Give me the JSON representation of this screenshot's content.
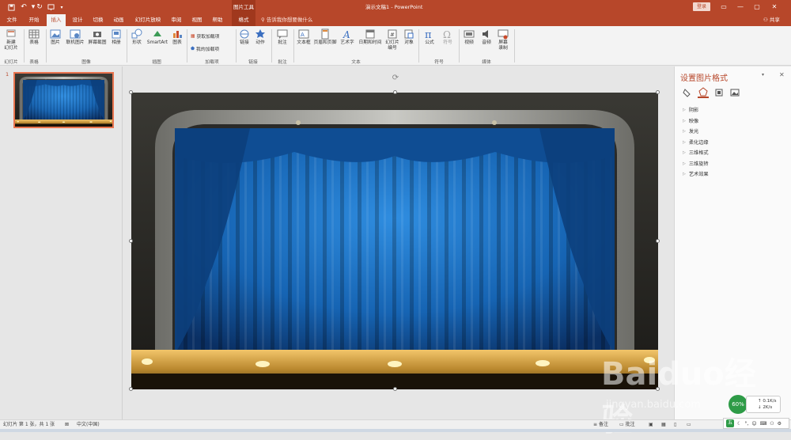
{
  "titlebar": {
    "context_tab": "图片工具",
    "title": "演示文稿1  -  PowerPoint",
    "login": "登录",
    "qa_save": "save-icon",
    "qa_undo": "undo-icon",
    "qa_redo": "redo-icon",
    "qa_present": "present-icon"
  },
  "tabs": [
    {
      "label": "文件"
    },
    {
      "label": "开始"
    },
    {
      "label": "插入"
    },
    {
      "label": "设计"
    },
    {
      "label": "切换"
    },
    {
      "label": "动画"
    },
    {
      "label": "幻灯片放映"
    },
    {
      "label": "审阅"
    },
    {
      "label": "视图"
    },
    {
      "label": "帮助"
    },
    {
      "label": "格式"
    }
  ],
  "tellme": "告诉我你想要做什么",
  "share": "共享",
  "ribbon": {
    "new_slide": "新建\n幻灯片",
    "table": "表格",
    "picture": "图片",
    "online_picture": "联机图片",
    "screenshot": "屏幕截图",
    "album": "相册",
    "shapes": "形状",
    "smartart": "SmartArt",
    "chart": "图表",
    "get_addins": "获取加载项",
    "my_addins": "我的加载项",
    "link": "链接",
    "action": "动作",
    "comment": "批注",
    "textbox": "文本框",
    "header_footer": "页眉和页脚",
    "wordart": "艺术字",
    "datetime": "日期和时间",
    "slide_number": "幻灯片\n编号",
    "object": "对象",
    "equation": "公式",
    "symbol": "符号",
    "video": "视频",
    "audio": "音频",
    "screen_record": "屏幕\n录制",
    "groups": {
      "slides": "幻灯片",
      "tables": "表格",
      "images": "图像",
      "illustrations": "插图",
      "addins": "加载项",
      "links": "链接",
      "comments": "批注",
      "text": "文本",
      "symbols": "符号",
      "media": "媒体"
    }
  },
  "thumbnails": [
    {
      "number": "1"
    }
  ],
  "format_pane": {
    "title": "设置图片格式",
    "items": [
      "阴影",
      "映像",
      "发光",
      "柔化边缘",
      "三维格式",
      "三维旋转",
      "艺术效果"
    ]
  },
  "statusbar": {
    "slide_info": "幻灯片 第 1 张，共 1 张",
    "language": "中文(中国)",
    "notes": "备注",
    "comments": "批注"
  },
  "netmeter": {
    "up": "0.1K/s",
    "down": "2K/s",
    "percent": "60"
  },
  "ime": {
    "label": "五"
  },
  "watermark": {
    "brand": "Baiduo经验",
    "url": "jingyan.baidu.com"
  },
  "colors": {
    "accent": "#b7472a",
    "ribbon_bg": "#f3f3f3",
    "curtain": "#1c6fc0",
    "stage_floor": "#c89a3a"
  }
}
